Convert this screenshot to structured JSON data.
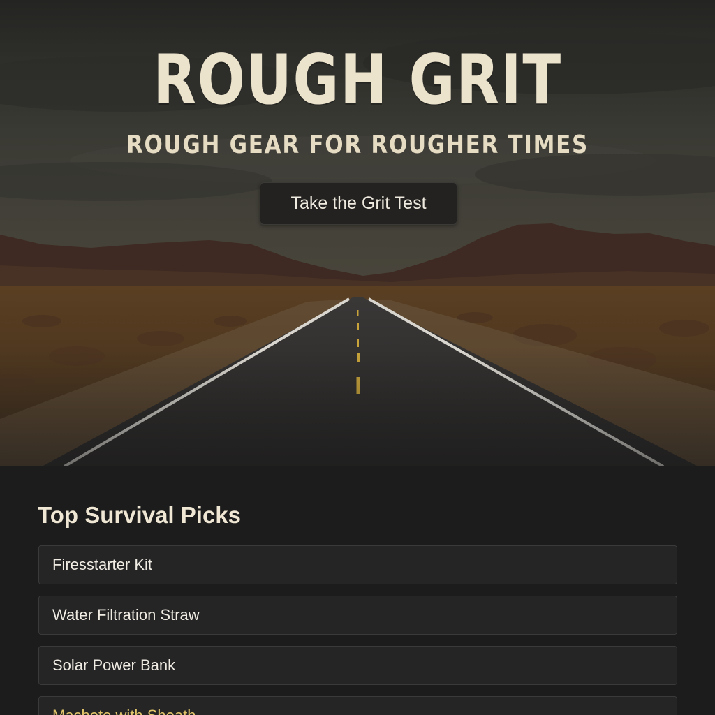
{
  "hero": {
    "title": "ROUGH GRIT",
    "tagline": "ROUGH GEAR FOR ROUGHER TIMES",
    "cta_label": "Take the Grit Test"
  },
  "picks": {
    "heading": "Top Survival Picks",
    "items": [
      {
        "label": "Firesstarter Kit"
      },
      {
        "label": "Water Filtration Straw"
      },
      {
        "label": "Solar Power Bank"
      },
      {
        "label": "Machete with Sheath"
      }
    ]
  },
  "colors": {
    "background": "#1c1c1c",
    "title": "#ece3cc",
    "accent": "#e2c56a",
    "card": "#252525"
  }
}
